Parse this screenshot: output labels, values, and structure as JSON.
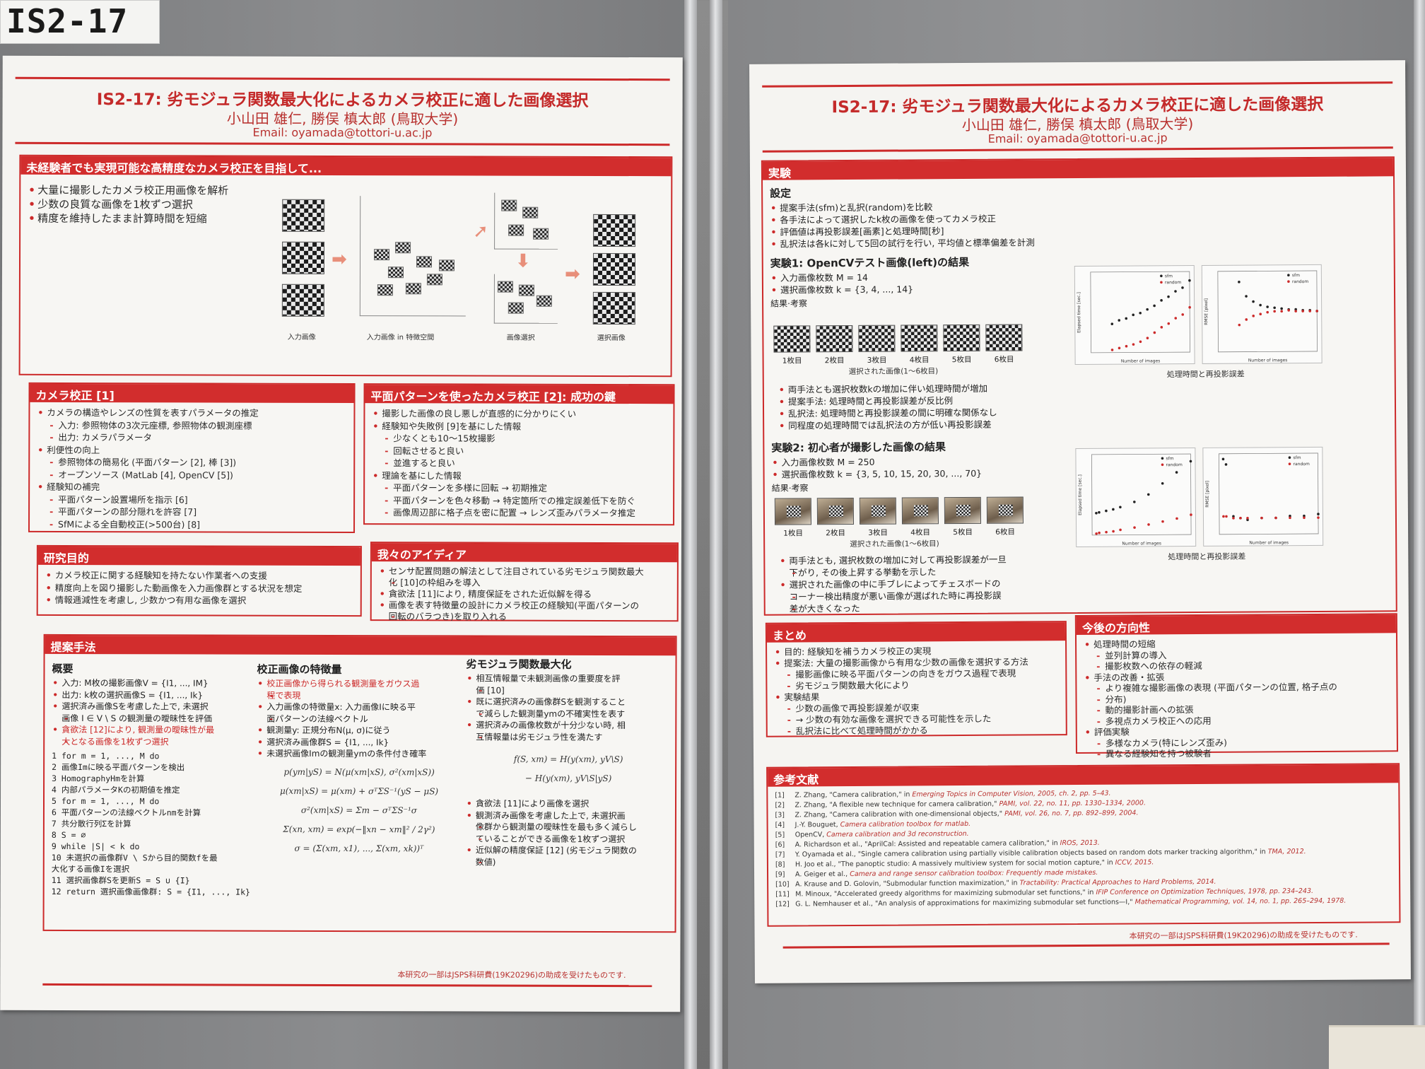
{
  "tag": {
    "label": "IS2-17"
  },
  "poster": {
    "title": "IS2-17: 劣モジュラ関数最大化によるカメラ校正に適した画像選択",
    "authors": "小山田 雄仁, 勝俣 槙太郎 (鳥取大学)",
    "email": "Email: oyamada@tottori-u.ac.jp",
    "acknowledgement": "本研究の一部はJSPS科研費(19K20296)の助成を受けたものです."
  },
  "left": {
    "intro": {
      "heading": "未経験者でも実現可能な高精度なカメラ校正を目指して...",
      "bullets": [
        "大量に撮影したカメラ校正用画像を解析",
        "少数の良質な画像を1枚ずつ選択",
        "精度を維持したまま計算時間を短縮"
      ],
      "captions": [
        "入力画像",
        "入力画像 in 特徴空間",
        "画像選択",
        "選択画像"
      ]
    },
    "calib": {
      "heading": "カメラ校正 [1]",
      "items": [
        {
          "t": "カメラの構造やレンズの性質を表すパラメータの推定",
          "lv": 0
        },
        {
          "t": "入力: 参照物体の3次元座標, 参照物体の観測座標",
          "lv": 1
        },
        {
          "t": "出力: カメラパラメータ",
          "lv": 1
        },
        {
          "t": "利便性の向上",
          "lv": 0
        },
        {
          "t": "参照物体の簡易化 (平面パターン [2], 棒 [3])",
          "lv": 1
        },
        {
          "t": "オープンソース (MatLab [4], OpenCV [5])",
          "lv": 1
        },
        {
          "t": "経験知の補完",
          "lv": 0
        },
        {
          "t": "平面パターン設置場所を指示 [6]",
          "lv": 1
        },
        {
          "t": "平面パターンの部分隠れを許容 [7]",
          "lv": 1
        },
        {
          "t": "SfMによる全自動校正(>500台) [8]",
          "lv": 1
        }
      ]
    },
    "plane": {
      "heading": "平面パターンを使ったカメラ校正 [2]: 成功の鍵",
      "items": [
        {
          "t": "撮影した画像の良し悪しが直感的に分かりにくい",
          "lv": 0
        },
        {
          "t": "経験知や失敗例 [9]を基にした情報",
          "lv": 0
        },
        {
          "t": "少なくとも10～15枚撮影",
          "lv": 1
        },
        {
          "t": "回転させると良い",
          "lv": 1
        },
        {
          "t": "並進すると良い",
          "lv": 1
        },
        {
          "t": "理論を基にした情報",
          "lv": 0
        },
        {
          "t": "平面パターンを多様に回転 → 初期推定",
          "lv": 1
        },
        {
          "t": "平面パターンを色々移動 → 特定箇所での推定誤差低下を防ぐ",
          "lv": 1
        },
        {
          "t": "画像周辺部に格子点を密に配置 → レンズ歪みパラメータ推定",
          "lv": 1
        }
      ]
    },
    "purpose": {
      "heading": "研究目的",
      "items": [
        "カメラ校正に関する経験知を持たない作業者への支援",
        "精度向上を図り撮影した動画像を入力画像群とする状況を想定",
        "情報逓減性を考慮し, 少数かつ有用な画像を選択"
      ]
    },
    "idea": {
      "heading": "我々のアイディア",
      "items": [
        "センサ配置問題の解法として注目されている劣モジュラ関数最大",
        "化 [10]の枠組みを導入",
        "貪欲法 [11]により, 精度保証をされた近似解を得る",
        "画像を表す特徴量の設計にカメラ校正の経験知(平面パターンの",
        "回転のバラつき)を取り入れる"
      ]
    },
    "method": {
      "heading": "提案手法",
      "col1_title": "概要",
      "col1_items": [
        "入力: M枚の撮影画像V = {I1, ..., IM}",
        "出力: k枚の選択画像S = {I1, ..., Ik}",
        "選択済み画像Sを考慮した上で, 未選択",
        "画像 I ∈ V \\ S の観測量の曖昧性を評価",
        "貪欲法 [12]により, 観測量の曖昧性が最",
        "大となる画像を1枚ずつ選択"
      ],
      "algo": [
        "1  for m = 1, ..., M do",
        "2    画像Imに映る平面パターンを検出",
        "3    HomographyHmを計算",
        "4  内部パラメータKの初期値を推定",
        "5  for m = 1, ..., M do",
        "6    平面パターンの法線ベクトルnmを計算",
        "7  共分散行列Σを計算",
        "8  S = ∅",
        "9  while |S| < k do",
        "10   未選択の画像群V \\ Sから目的関数fを最",
        "     大化する画像Iを選択",
        "11   選択画像群Sを更新S = S ∪ {I}",
        "12 return 選択画像画像群: S = {I1, ..., Ik}"
      ],
      "col2_title": "校正画像の特徴量",
      "col2_items": [
        "校正画像から得られる観測量をガウス過",
        "程で表現",
        "入力画像の特徴量x: 入力画像Iに映る平",
        "面パターンの法線ベクトル",
        "観測量y: 正規分布N(μ, σ)に従う",
        "選択済み画像群S = {I1, ..., Ik}",
        "未選択画像Imの観測量ymの条件付き確率"
      ],
      "formulas": [
        "p(ym|yS) = N(μ(xm|xS), σ²(xm|xS))",
        "μ(xm|xS) = μ(xm) + σᵀΣS⁻¹(yS − μS)",
        "σ²(xm|xS) = Σm − σᵀΣS⁻¹σ",
        "Σ(xn, xm) = exp(−‖xn − xm‖² / 2γ²)",
        "σ = (Σ(xm, x1), ..., Σ(xm, xk))ᵀ"
      ],
      "col3_title": "劣モジュラ関数最大化",
      "col3_items": [
        "相互情報量で未観測画像の重要度を評",
        "価 [10]",
        "既に選択済みの画像群Sを観測すること",
        "で減らした観測量ymの不確実性を表す",
        "選択済みの画像枚数が十分少ない時, 相",
        "互情報量は劣モジュラ性を満たす"
      ],
      "formula3": [
        "f(S, xm) = H(y(xm), yV\\S)",
        "− H(y(xm), yV\\S|yS)"
      ],
      "col3_items2": [
        "貪欲法 [11]により画像を選択",
        "観測済み画像を考慮した上で, 未選択画",
        "像群から観測量の曖昧性を最も多く減らし",
        "ていることができる画像を1枚ずつ選択",
        "近似解の精度保証 [12] (劣モジュラ関数の",
        "数値)"
      ]
    }
  },
  "right": {
    "exp": {
      "heading": "実験",
      "setting_title": "設定",
      "setting_items": [
        "提案手法(sfm)と乱択(random)を比較",
        "各手法によって選択したk枚の画像を使ってカメラ校正",
        "評価値は再投影誤差[画素]と処理時間[秒]",
        "乱択法は各kに対して5回の試行を行い, 平均値と標準偏差を計測"
      ],
      "exp1_title": "実験1: OpenCVテスト画像(left)の結果",
      "exp1_items": [
        "入力画像枚数 M = 14",
        "選択画像枚数 k = {3, 4, ..., 14}"
      ],
      "result_label": "結果·考察",
      "frame_labels": [
        "1枚目",
        "2枚目",
        "3枚目",
        "4枚目",
        "5枚目",
        "6枚目"
      ],
      "strip_caption": "選択された画像(1～6枚目)",
      "plot_caption": "処理時間と再投影誤差",
      "exp1_findings": [
        "両手法とも選択枚数kの増加に伴い処理時間が増加",
        "提案手法: 処理時間と再投影誤差が反比例",
        "乱択法: 処理時間と再投影誤差の間に明確な関係なし",
        "同程度の処理時間では乱択法の方が低い再投影誤差"
      ],
      "exp2_title": "実験2: 初心者が撮影した画像の結果",
      "exp2_items": [
        "入力画像枚数 M = 250",
        "選択画像枚数 k = {3, 5, 10, 15, 20, 30, ..., 70}"
      ],
      "exp2_findings": [
        "両手法とも, 選択枚数の増加に対して再投影誤差が一旦",
        "下がり, その後上昇する挙動を示した",
        "選択された画像の中に手ブレによってチェスボードの",
        "コーナー検出精度が悪い画像が選ばれた時に再投影誤",
        "差が大きくなった"
      ],
      "legend": [
        "sfm",
        "random"
      ]
    },
    "summary": {
      "heading": "まとめ",
      "items": [
        {
          "t": "目的: 経験知を補うカメラ校正の実現",
          "lv": 0
        },
        {
          "t": "提案法: 大量の撮影画像から有用な少数の画像を選択する方法",
          "lv": 0
        },
        {
          "t": "撮影画像に映る平面パターンの向きをガウス過程で表現",
          "lv": 1
        },
        {
          "t": "劣モジュラ関数最大化により",
          "lv": 1
        },
        {
          "t": "実験結果",
          "lv": 0
        },
        {
          "t": "少数の画像で再投影誤差が収束",
          "lv": 1
        },
        {
          "t": "→ 少数の有効な画像を選択できる可能性を示した",
          "lv": 1
        },
        {
          "t": "乱択法に比べて処理時間がかかる",
          "lv": 1
        }
      ]
    },
    "future": {
      "heading": "今後の方向性",
      "items": [
        {
          "t": "処理時間の短縮",
          "lv": 0
        },
        {
          "t": "並列計算の導入",
          "lv": 1
        },
        {
          "t": "撮影枚数への依存の軽減",
          "lv": 1
        },
        {
          "t": "手法の改善・拡張",
          "lv": 0
        },
        {
          "t": "より複雑な撮影画像の表現 (平面パターンの位置, 格子点の",
          "lv": 1
        },
        {
          "t": "分布)",
          "lv": 1
        },
        {
          "t": "動的撮影計画への拡張",
          "lv": 1
        },
        {
          "t": "多視点カメラ校正への応用",
          "lv": 1
        },
        {
          "t": "評価実験",
          "lv": 0
        },
        {
          "t": "多様なカメラ(特にレンズ歪み)",
          "lv": 1
        },
        {
          "t": "異なる経験知を持つ被験者",
          "lv": 1
        }
      ]
    },
    "refs": {
      "heading": "参考文献",
      "items": [
        {
          "n": "[1]",
          "a": "Z. Zhang, \"Camera calibration,\" in ",
          "v": "Emerging Topics in Computer Vision",
          "r": ", 2005, ch. 2, pp. 5–43."
        },
        {
          "n": "[2]",
          "a": "Z. Zhang, \"A flexible new technique for camera calibration,\" ",
          "v": "PAMI",
          "r": ", vol. 22, no. 11, pp. 1330–1334, 2000."
        },
        {
          "n": "[3]",
          "a": "Z. Zhang, \"Camera calibration with one-dimensional objects,\" ",
          "v": "PAMI",
          "r": ", vol. 26, no. 7, pp. 892–899, 2004."
        },
        {
          "n": "[4]",
          "a": "J.-Y. Bouguet, ",
          "v": "Camera calibration toolbox for matlab",
          "r": "."
        },
        {
          "n": "[5]",
          "a": "OpenCV, ",
          "v": "Camera calibration and 3d reconstruction",
          "r": "."
        },
        {
          "n": "[6]",
          "a": "A. Richardson et al., \"AprilCal: Assisted and repeatable camera calibration,\" in ",
          "v": "IROS",
          "r": ", 2013."
        },
        {
          "n": "[7]",
          "a": "Y. Oyamada et al., \"Single camera calibration using partially visible calibration objects based on random dots marker tracking algorithm,\" in ",
          "v": "TMA",
          "r": ", 2012."
        },
        {
          "n": "[8]",
          "a": "H. Joo et al., \"The panoptic studio: A massively multiview system for social motion capture,\" in ",
          "v": "ICCV",
          "r": ", 2015."
        },
        {
          "n": "[9]",
          "a": "A. Geiger et al., ",
          "v": "Camera and range sensor calibration toolbox: Frequently made mistakes",
          "r": "."
        },
        {
          "n": "[10]",
          "a": "A. Krause and D. Golovin, \"Submodular function maximization,\" in ",
          "v": "Tractability: Practical Approaches to Hard Problems",
          "r": ", 2014."
        },
        {
          "n": "[11]",
          "a": "M. Minoux, \"Accelerated greedy algorithms for maximizing submodular set functions,\" in ",
          "v": "IFIP Conference on Optimization Techniques",
          "r": ", 1978, pp. 234–243."
        },
        {
          "n": "[12]",
          "a": "G. L. Nemhauser et al., \"An analysis of approximations for maximizing submodular set functions—I,\" ",
          "v": "Mathematical Programming",
          "r": ", vol. 14, no. 1, pp. 265–294, 1978."
        }
      ]
    }
  },
  "chart_data": [
    {
      "type": "scatter",
      "title": "",
      "xlabel": "Number of images",
      "ylabel": "Elapsed time [sec.]",
      "x": [
        3,
        4,
        5,
        6,
        7,
        8,
        9,
        10,
        11,
        12,
        13,
        14
      ],
      "series": [
        {
          "name": "sfm",
          "values": [
            0.32,
            0.36,
            0.38,
            0.42,
            0.44,
            0.48,
            0.52,
            0.58,
            0.62,
            0.68,
            0.72,
            0.8
          ]
        },
        {
          "name": "random",
          "values": [
            0.03,
            0.05,
            0.07,
            0.09,
            0.12,
            0.16,
            0.22,
            0.28,
            0.32,
            0.38,
            0.42,
            0.5
          ]
        }
      ],
      "xlim": [
        0,
        14
      ],
      "ylim": [
        0,
        0.9
      ]
    },
    {
      "type": "scatter",
      "title": "",
      "xlabel": "Number of images",
      "ylabel": "RMSE [pixel]",
      "x": [
        3,
        4,
        5,
        6,
        7,
        8,
        9,
        10,
        11,
        12,
        13,
        14
      ],
      "series": [
        {
          "name": "sfm",
          "values": [
            0.78,
            0.62,
            0.56,
            0.52,
            0.5,
            0.49,
            0.48,
            0.47,
            0.47,
            0.46,
            0.46,
            0.45
          ]
        },
        {
          "name": "random",
          "values": [
            0.3,
            0.36,
            0.4,
            0.42,
            0.44,
            0.45,
            0.45,
            0.46,
            0.45,
            0.45,
            0.45,
            0.45
          ]
        }
      ],
      "xlim": [
        0,
        14
      ],
      "ylim": [
        0,
        0.9
      ]
    },
    {
      "type": "scatter",
      "title": "",
      "xlabel": "Number of images",
      "ylabel": "Elapsed time [sec.]",
      "x": [
        3,
        5,
        10,
        15,
        20,
        30,
        40,
        50,
        60,
        70
      ],
      "series": [
        {
          "name": "sfm",
          "values": [
            30,
            31,
            33,
            35,
            38,
            45,
            55,
            70,
            85,
            100
          ]
        },
        {
          "name": "random",
          "values": [
            2,
            3,
            4,
            5,
            7,
            10,
            14,
            18,
            22,
            27
          ]
        }
      ],
      "xlim": [
        0,
        70
      ],
      "ylim": [
        0,
        110
      ]
    },
    {
      "type": "scatter",
      "title": "",
      "xlabel": "Number of images",
      "ylabel": "RMSE [pixel]",
      "x": [
        3,
        5,
        10,
        15,
        20,
        30,
        40,
        50,
        60,
        70
      ],
      "series": [
        {
          "name": "sfm",
          "values": [
            4.2,
            3.9,
            1.0,
            0.9,
            0.8,
            0.9,
            0.9,
            1.0,
            1.0,
            1.1
          ]
        },
        {
          "name": "random",
          "values": [
            1.0,
            1.0,
            0.9,
            0.9,
            0.9,
            0.9,
            0.9,
            0.9,
            0.9,
            0.9
          ]
        }
      ],
      "xlim": [
        0,
        70
      ],
      "ylim": [
        0,
        4.5
      ]
    }
  ]
}
